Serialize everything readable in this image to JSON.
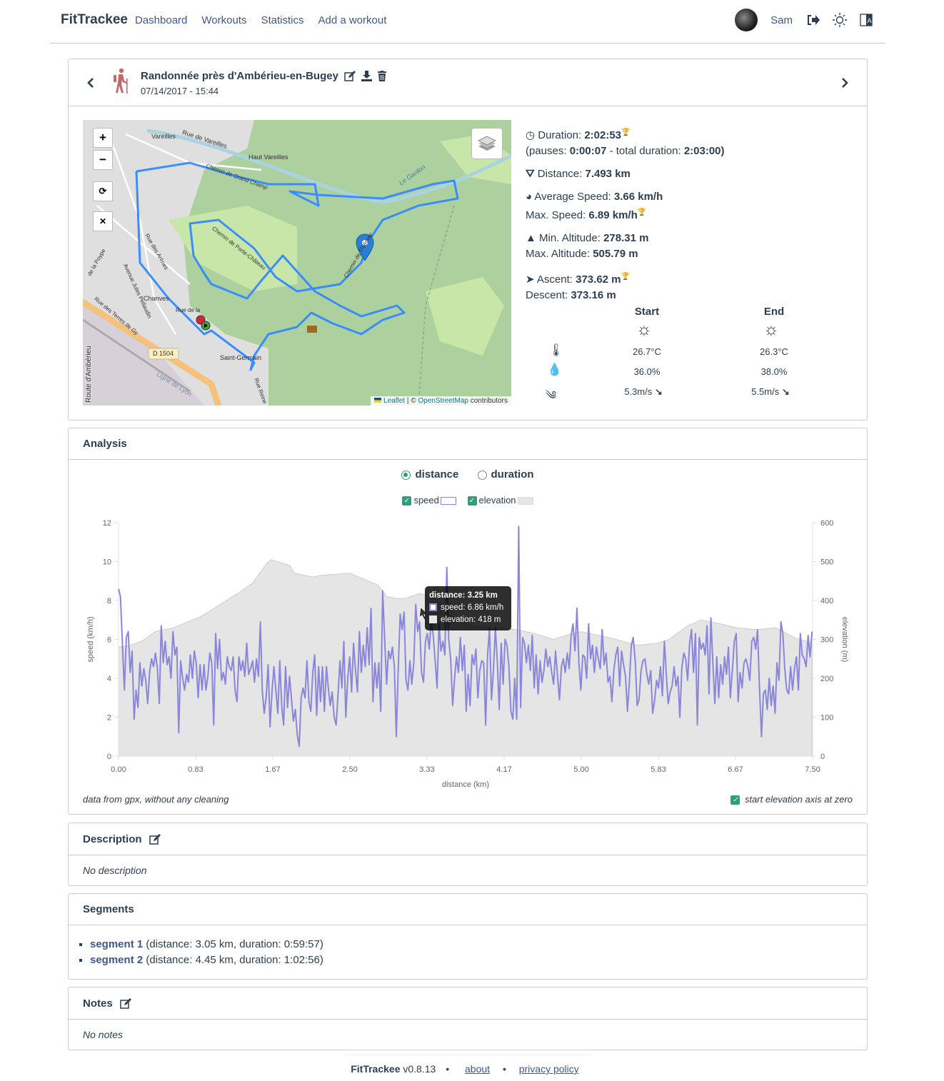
{
  "nav": {
    "brand": "FitTrackee",
    "links": [
      "Dashboard",
      "Workouts",
      "Statistics",
      "Add a workout"
    ],
    "user": "Sam",
    "icons": [
      "logout-icon",
      "sun-icon",
      "language-icon"
    ]
  },
  "workout": {
    "title": "Randonnée près d'Ambérieu-en-Bugey",
    "date": "07/14/2017 - 15:44",
    "sport_icon": "hiking-icon",
    "sport_color": "#c06a6a"
  },
  "map": {
    "zoom_in": "+",
    "zoom_out": "−",
    "attribution_leaflet": "Leaflet",
    "attribution_sep": " | © ",
    "attribution_osm": "OpenStreetMap",
    "attribution_tail": " contributors",
    "labels": [
      "Vareilles",
      "Rue de Vareilles",
      "Haut Vareilles",
      "Chemin de Grand Champ",
      "Le Gardon",
      "Chemin de Porte-Château",
      "Rue des Arènes",
      "Avenue Jules Pellaudin",
      "Chanves",
      "Rue des Terres de Gy",
      "D 1504",
      "Saint-Germain",
      "Ligne de Lyon",
      "Rue Reine",
      "de la Poype",
      "Route d'Ambérieu",
      "Chemin de Thiémay",
      "Rue de la"
    ]
  },
  "stats": {
    "duration_label": "Duration: ",
    "duration": "2:02:53",
    "pauses_label": "(pauses: ",
    "pauses": "0:00:07",
    "total_label": " - total duration: ",
    "total": "2:03:00",
    "close": ")",
    "distance_label": "Distance: ",
    "distance": "7.493 km",
    "avg_speed_label": "Average Speed: ",
    "avg_speed": "3.66 km/h",
    "max_speed_label": "Max. Speed: ",
    "max_speed": "6.89 km/h",
    "min_alt_label": "Min. Altitude: ",
    "min_alt": "278.31 m",
    "max_alt_label": "Max. Altitude: ",
    "max_alt": "505.79 m",
    "ascent_label": "Ascent: ",
    "ascent": "373.62 m",
    "descent_label": "Descent: ",
    "descent": "373.16 m"
  },
  "weather": {
    "start": {
      "label": "Start",
      "temp": "26.7°C",
      "humidity": "36.0%",
      "wind": "5.3m/s"
    },
    "end": {
      "label": "End",
      "temp": "26.3°C",
      "humidity": "38.0%",
      "wind": "5.5m/s"
    }
  },
  "analysis": {
    "title": "Analysis",
    "radio_distance": "distance",
    "radio_duration": "duration",
    "selected": "distance",
    "legend_speed": "speed",
    "legend_elevation": "elevation",
    "note": "data from gpx, without any cleaning",
    "zero_label": "start elevation axis at zero",
    "tooltip": {
      "title": "distance: 3.25 km",
      "speed": "speed: 6.86 km/h",
      "elevation": "elevation: 418 m"
    }
  },
  "chart_data": {
    "type": "line",
    "xlabel": "distance (km)",
    "ylabel": "speed (km/h)",
    "y2label": "elevation (m)",
    "xlim": [
      0,
      7.5
    ],
    "ylim": [
      0,
      12
    ],
    "y2lim": [
      0,
      600
    ],
    "xticks": [
      "0.00",
      "0.83",
      "1.67",
      "2.50",
      "3.33",
      "4.17",
      "5.00",
      "5.83",
      "6.67",
      "7.50"
    ],
    "yticks": [
      "0",
      "2",
      "4",
      "6",
      "8",
      "10",
      "12"
    ],
    "y2ticks": [
      "0",
      "100",
      "200",
      "300",
      "400",
      "500",
      "600"
    ],
    "speed_color": "#8a86dc",
    "elevation_color": "#e5e5e5",
    "total_distance": 7.493,
    "series": [
      {
        "name": "speed",
        "values": [
          8.6,
          8.2,
          5.8,
          3.4,
          6.1,
          6.4,
          4.3,
          5.4,
          1.9,
          3.4,
          2.5,
          4.8,
          3.6,
          4.5,
          3.9,
          2.7,
          4.3,
          5.0,
          4.6,
          5.3,
          4.5,
          2.7,
          6.7,
          4.8,
          5.9,
          4.7,
          5.1,
          4.0,
          6.4,
          5.2,
          5.6,
          1.2,
          4.9,
          4.0,
          3.4,
          4.2,
          3.8,
          5.2,
          4.0,
          5.4,
          4.8,
          3.0,
          4.7,
          3.4,
          4.7,
          3.4,
          4.1,
          5.3,
          4.8,
          1.6,
          6.3,
          4.5,
          6.0,
          3.9,
          4.3,
          3.7,
          5.1,
          4.6,
          4.4,
          5.1,
          3.4,
          2.8,
          5.1,
          4.4,
          4.9,
          4.1,
          5.8,
          4.2,
          4.5,
          4.9,
          3.8,
          5.0,
          4.1,
          6.9,
          3.4,
          2.2,
          3.0,
          4.7,
          1.5,
          3.3,
          4.6,
          3.4,
          2.2,
          4.9,
          2.6,
          1.6,
          4.6,
          2.5,
          4.1,
          3.0,
          1.8,
          2.4,
          1.1,
          0.5,
          3.0,
          3.5,
          3.0,
          4.9,
          2.8,
          2.3,
          4.3,
          5.2,
          2.1,
          4.6,
          2.8,
          4.6,
          2.3,
          4.6,
          3.5,
          2.6,
          3.3,
          2.0,
          1.6,
          3.2,
          4.9,
          3.5,
          5.9,
          2.0,
          4.0,
          5.1,
          3.3,
          5.8,
          4.4,
          3.3,
          6.4,
          4.3,
          5.7,
          4.6,
          6.6,
          4.7,
          7.6,
          2.8,
          4.8,
          3.5,
          4.8,
          2.3,
          8.5,
          6.0,
          3.7,
          5.4,
          5.0,
          5.6,
          4.6,
          1.0,
          4.5,
          7.3,
          6.5,
          7.4,
          3.9,
          3.4,
          4.9,
          3.7,
          4.8,
          7.8,
          6.4,
          6.9,
          4.3,
          3.8,
          5.9,
          6.3,
          5.5,
          7.0,
          6.2,
          4.9,
          3.5,
          6.8,
          5.4,
          5.9,
          5.2,
          9.7,
          6.0,
          5.0,
          2.6,
          4.0,
          5.1,
          4.3,
          6.1,
          4.4,
          5.7,
          2.3,
          4.2,
          2.6,
          5.2,
          4.7,
          5.5,
          3.0,
          4.4,
          4.9,
          4.8,
          1.6,
          5.2,
          6.6,
          2.9,
          4.4,
          6.6,
          4.9,
          2.4,
          5.8,
          3.7,
          6.0,
          5.7,
          4.6,
          2.3,
          1.9,
          4.0,
          1.9,
          11.8,
          2.5,
          6.1,
          5.8,
          4.8,
          5.7,
          4.4,
          6.2,
          3.5,
          5.2,
          3.2,
          4.9,
          3.8,
          4.4,
          5.5,
          4.6,
          5.1,
          4.3,
          3.7,
          5.4,
          4.1,
          2.9,
          4.6,
          5.0,
          4.3,
          5.3,
          4.5,
          6.2,
          6.8,
          5.4,
          7.6,
          4.8,
          3.4,
          5.2,
          5.1,
          4.0,
          6.8,
          5.0,
          5.7,
          4.3,
          5.6,
          5.0,
          4.5,
          6.5,
          4.7,
          5.3,
          3.8,
          4.1,
          2.8,
          4.4,
          5.2,
          5.6,
          3.6,
          5.4,
          4.7,
          4.1,
          2.3,
          3.8,
          5.7,
          6.1,
          4.9,
          2.6,
          2.9,
          4.4,
          4.9,
          5.0,
          4.2,
          3.7,
          4.4,
          2.2,
          2.9,
          3.9,
          3.5,
          4.6,
          3.1,
          5.9,
          4.2,
          2.7,
          3.3,
          3.6,
          4.6,
          3.6,
          4.1,
          2.0,
          4.5,
          5.3,
          5.0,
          3.9,
          5.8,
          6.5,
          4.3,
          6.3,
          1.6,
          6.1,
          5.5,
          5.8,
          5.2,
          6.7,
          3.2,
          7.1,
          4.7,
          2.7,
          5.1,
          3.0,
          4.7,
          3.7,
          5.1,
          4.2,
          5.6,
          3.0,
          4.4,
          5.9,
          6.3,
          2.8,
          4.3,
          3.5,
          4.8,
          5.0,
          4.6,
          3.9,
          5.9,
          6.1,
          5.5,
          6.5,
          3.5,
          1.0,
          3.2,
          3.4,
          2.4,
          4.0,
          2.6,
          3.6,
          2.2,
          4.8,
          3.9,
          6.9,
          6.3,
          4.5,
          3.4,
          3.2,
          4.6,
          3.4,
          4.5,
          5.1,
          3.4,
          6.3,
          5.2,
          5.0,
          4.6,
          6.2,
          5.1,
          6.4
        ]
      },
      {
        "name": "elevation",
        "points": [
          [
            0,
            280
          ],
          [
            0.13,
            285
          ],
          [
            0.25,
            295
          ],
          [
            0.4,
            320
          ],
          [
            0.6,
            330
          ],
          [
            0.9,
            360
          ],
          [
            1.1,
            390
          ],
          [
            1.3,
            420
          ],
          [
            1.45,
            445
          ],
          [
            1.6,
            495
          ],
          [
            1.65,
            505
          ],
          [
            1.85,
            490
          ],
          [
            1.9,
            470
          ],
          [
            2.1,
            460
          ],
          [
            2.2,
            465
          ],
          [
            2.5,
            470
          ],
          [
            2.7,
            450
          ],
          [
            2.8,
            440
          ],
          [
            2.9,
            410
          ],
          [
            3.0,
            405
          ],
          [
            3.1,
            405
          ],
          [
            3.25,
            418
          ],
          [
            3.4,
            410
          ],
          [
            3.6,
            360
          ],
          [
            3.8,
            335
          ],
          [
            4.0,
            330
          ],
          [
            4.3,
            325
          ],
          [
            4.5,
            315
          ],
          [
            4.7,
            300
          ],
          [
            4.9,
            315
          ],
          [
            5.0,
            320
          ],
          [
            5.3,
            305
          ],
          [
            5.6,
            285
          ],
          [
            5.83,
            290
          ],
          [
            5.95,
            300
          ],
          [
            6.15,
            335
          ],
          [
            6.3,
            350
          ],
          [
            6.5,
            340
          ],
          [
            6.67,
            330
          ],
          [
            6.9,
            325
          ],
          [
            7.1,
            330
          ],
          [
            7.3,
            305
          ],
          [
            7.493,
            290
          ]
        ]
      }
    ]
  },
  "description": {
    "title": "Description",
    "text": "No description"
  },
  "segments": {
    "title": "Segments",
    "items": [
      {
        "link": "segment 1",
        "detail": " (distance: 3.05 km, duration: 0:59:57)"
      },
      {
        "link": "segment 2",
        "detail": " (distance: 4.45 km, duration: 1:02:56)"
      }
    ]
  },
  "notes": {
    "title": "Notes",
    "text": "No notes"
  },
  "footer": {
    "brand": "FitTrackee",
    "version": " v0.8.13",
    "about": "about",
    "privacy": "privacy policy",
    "sep": "•"
  }
}
